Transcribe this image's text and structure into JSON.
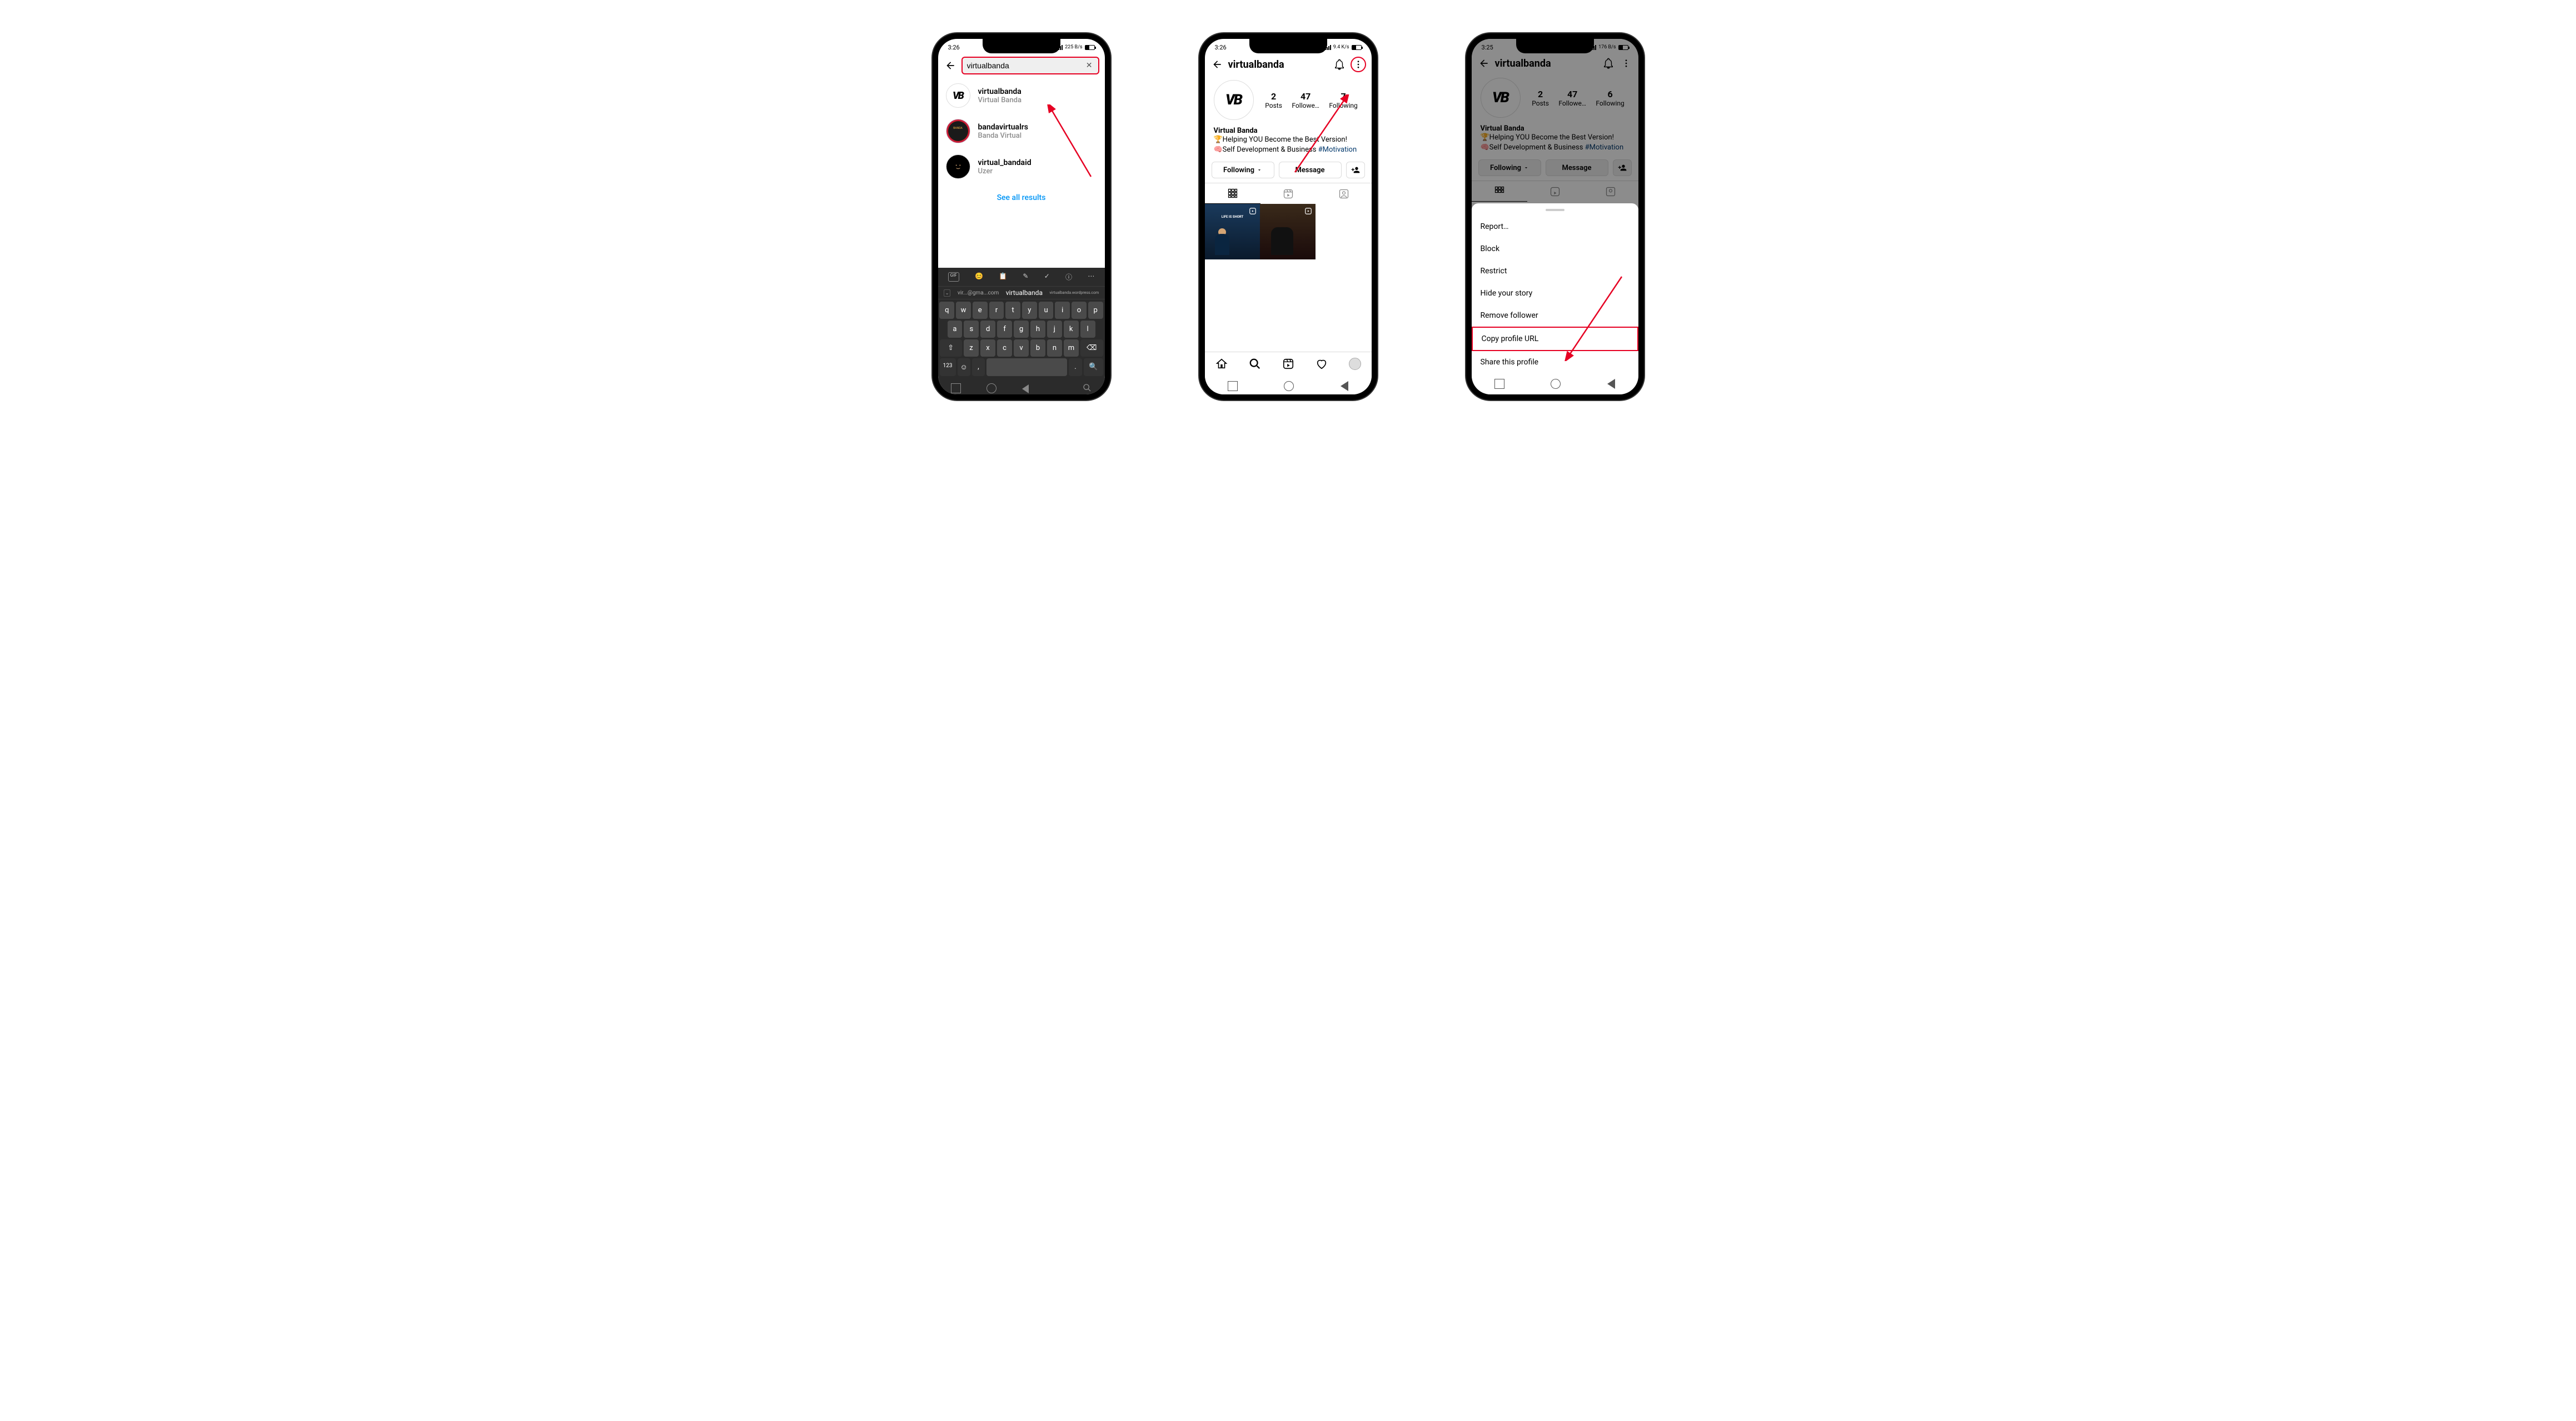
{
  "status": {
    "time1": "3:26",
    "time2": "3:26",
    "time3": "3:25",
    "net_speed1": "225 B/s",
    "net_speed2": "9.4 K/s",
    "net_speed3": "176 B/s"
  },
  "search": {
    "query": "virtualbanda",
    "see_all": "See all results",
    "results": [
      {
        "username": "virtualbanda",
        "display": "Virtual Banda"
      },
      {
        "username": "bandavirtualrs",
        "display": "Banda Virtual"
      },
      {
        "username": "virtual_bandaid",
        "display": "Uzer"
      }
    ]
  },
  "keyboard": {
    "toolbar": [
      "GIF",
      "😊",
      "📋",
      "✎",
      "✓",
      "ⓘ",
      "⋯"
    ],
    "suggest_left": "vir...@gma...com",
    "suggest_center": "virtualbanda",
    "suggest_right": "virtualbanda.wordpress.com",
    "row1": [
      "q",
      "w",
      "e",
      "r",
      "t",
      "y",
      "u",
      "i",
      "o",
      "p"
    ],
    "row2": [
      "a",
      "s",
      "d",
      "f",
      "g",
      "h",
      "j",
      "k",
      "l"
    ],
    "row3": [
      "⇧",
      "z",
      "x",
      "c",
      "v",
      "b",
      "n",
      "m",
      "⌫"
    ],
    "row4": [
      "123",
      "☺",
      ",",
      "space",
      ".",
      "🔍"
    ]
  },
  "profile": {
    "username": "virtualbanda",
    "stats_p2": {
      "posts": "2",
      "followers": "47",
      "following": "7"
    },
    "stats_p3": {
      "posts": "2",
      "followers": "47",
      "following": "6"
    },
    "labels": {
      "posts": "Posts",
      "followers": "Followe…",
      "following": "Following"
    },
    "name": "Virtual Banda",
    "bio_line1": "🏆Helping YOU Become the Best Version!",
    "bio_line2_a": "🧠Self Development & Business ",
    "bio_line2_hashtag": "#Motivation",
    "btn_following": "Following",
    "btn_message": "Message",
    "post_caption": "LIFE IS SHORT"
  },
  "sheet": {
    "items": [
      "Report…",
      "Block",
      "Restrict",
      "Hide your story",
      "Remove follower",
      "Copy profile URL",
      "Share this profile"
    ]
  }
}
